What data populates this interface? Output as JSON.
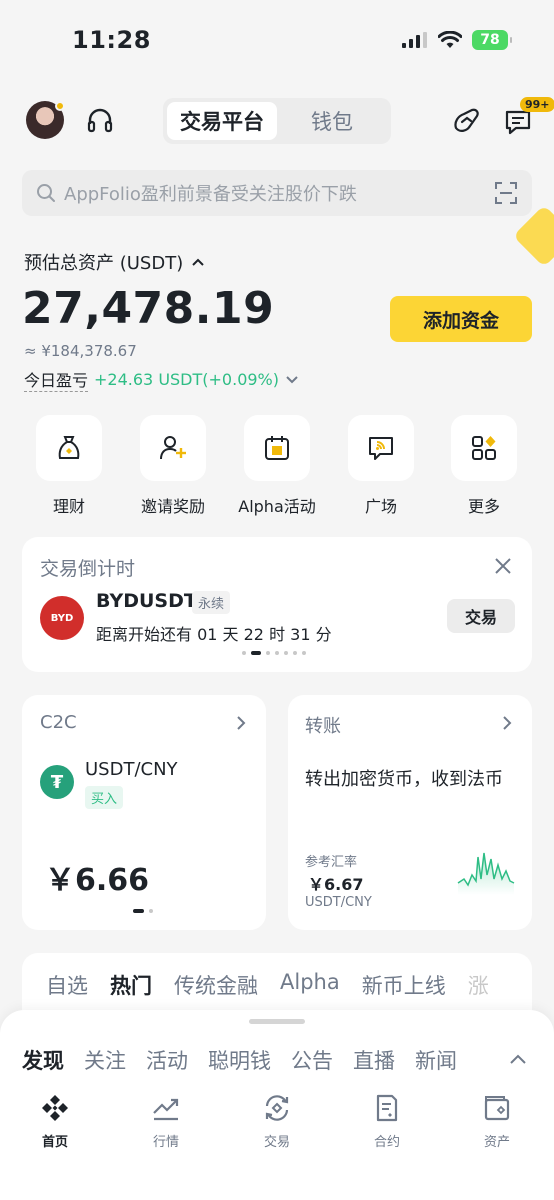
{
  "status": {
    "time": "11:28",
    "battery": "78"
  },
  "header": {
    "segments": [
      "交易平台",
      "钱包"
    ],
    "active_segment": 0,
    "badge": "99+"
  },
  "search": {
    "placeholder": "AppFolio盈利前景备受关注股价下跌"
  },
  "assets": {
    "label": "预估总资产 (USDT)",
    "total": "27,478.19",
    "cny": "≈ ¥184,378.67",
    "pnl_label": "今日盈亏",
    "pnl_value": "+24.63 USDT(+0.09%)",
    "add_funds": "添加资金"
  },
  "quick": [
    {
      "label": "理财",
      "icon": "moneybag-icon"
    },
    {
      "label": "邀请奖励",
      "icon": "invite-user-icon"
    },
    {
      "label": "Alpha活动",
      "icon": "calendar-icon"
    },
    {
      "label": "广场",
      "icon": "broadcast-icon"
    },
    {
      "label": "更多",
      "icon": "grid-icon"
    }
  ],
  "countdown": {
    "title": "交易倒计时",
    "logo_text": "BYD",
    "pair": "BYDUSDT",
    "tag": "永续",
    "desc": "距离开始还有 01 天 22 时 31 分",
    "button": "交易"
  },
  "c2c": {
    "title": "C2C",
    "pair": "USDT/CNY",
    "tag": "买入",
    "price": "￥6.66"
  },
  "transfer": {
    "title": "转账",
    "desc": "转出加密货币，收到法币",
    "rate_label": "参考汇率",
    "rate": "￥6.67",
    "pair": "USDT/CNY"
  },
  "market_tabs": [
    "自选",
    "热门",
    "传统金融",
    "Alpha",
    "新币上线",
    "涨"
  ],
  "market_active": 1,
  "feed_tabs": [
    "发现",
    "关注",
    "活动",
    "聪明钱",
    "公告",
    "直播",
    "新闻"
  ],
  "feed_active": 0,
  "nav": [
    {
      "label": "首页",
      "icon": "home-diamond-icon"
    },
    {
      "label": "行情",
      "icon": "chart-icon"
    },
    {
      "label": "交易",
      "icon": "trade-icon"
    },
    {
      "label": "合约",
      "icon": "contract-icon"
    },
    {
      "label": "资产",
      "icon": "wallet-icon"
    }
  ],
  "colors": {
    "accent": "#fcd535",
    "up": "#2ebd85",
    "text": "#1e2329",
    "muted": "#707a8a"
  }
}
